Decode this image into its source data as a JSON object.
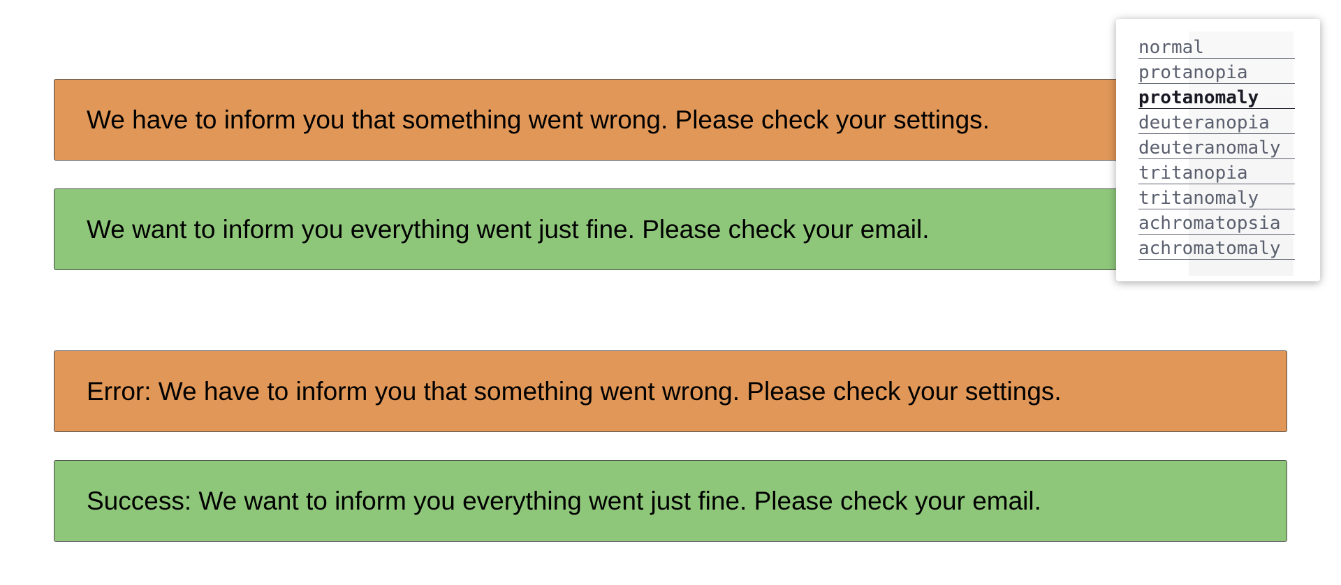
{
  "alerts": [
    {
      "type": "error",
      "text": "We have to inform you that something went wrong. Please check your settings."
    },
    {
      "type": "success",
      "text": "We want to inform you everything went just fine. Please check your email."
    },
    {
      "type": "error",
      "text": "Error: We have to inform you that something went wrong. Please check your settings."
    },
    {
      "type": "success",
      "text": "Success: We want to inform you everything went just fine. Please check your email."
    }
  ],
  "colors": {
    "error_bg": "#e09757",
    "success_bg": "#8ec77a",
    "border": "#4a4a4a",
    "link": "#5a5f6e",
    "link_active": "#1a1a24"
  },
  "vision_filter": {
    "active": "protanomaly",
    "options": [
      "normal",
      "protanopia",
      "protanomaly",
      "deuteranopia",
      "deuteranomaly",
      "tritanopia",
      "tritanomaly",
      "achromatopsia",
      "achromatomaly"
    ]
  }
}
